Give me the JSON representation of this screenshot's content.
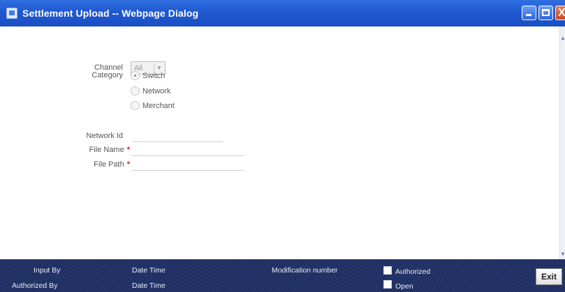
{
  "window": {
    "title": "Settlement Upload -- Webpage Dialog",
    "close_glyph": "X"
  },
  "form": {
    "channel_label": "Channel",
    "channel_value": "All",
    "category_label": "Category",
    "category_options": [
      "Switch",
      "Network",
      "Merchant"
    ],
    "category_selected": "Switch",
    "network_id_label": "Network Id",
    "network_id_value": "",
    "file_name_label": "File Name",
    "file_name_value": "",
    "file_path_label": "File Path",
    "file_path_value": "",
    "required_marker": "*"
  },
  "footer": {
    "input_by_label": "Input By",
    "authorized_by_label": "Authorized By",
    "date_time_label_1": "Date Time",
    "date_time_label_2": "Date Time",
    "modification_number_label": "Modification number",
    "authorized_label": "Authorized",
    "open_label": "Open",
    "exit_label": "Exit"
  },
  "colors": {
    "titlebar": "#1f58d0",
    "footer": "#1f2f63",
    "required": "#d51a1a"
  }
}
